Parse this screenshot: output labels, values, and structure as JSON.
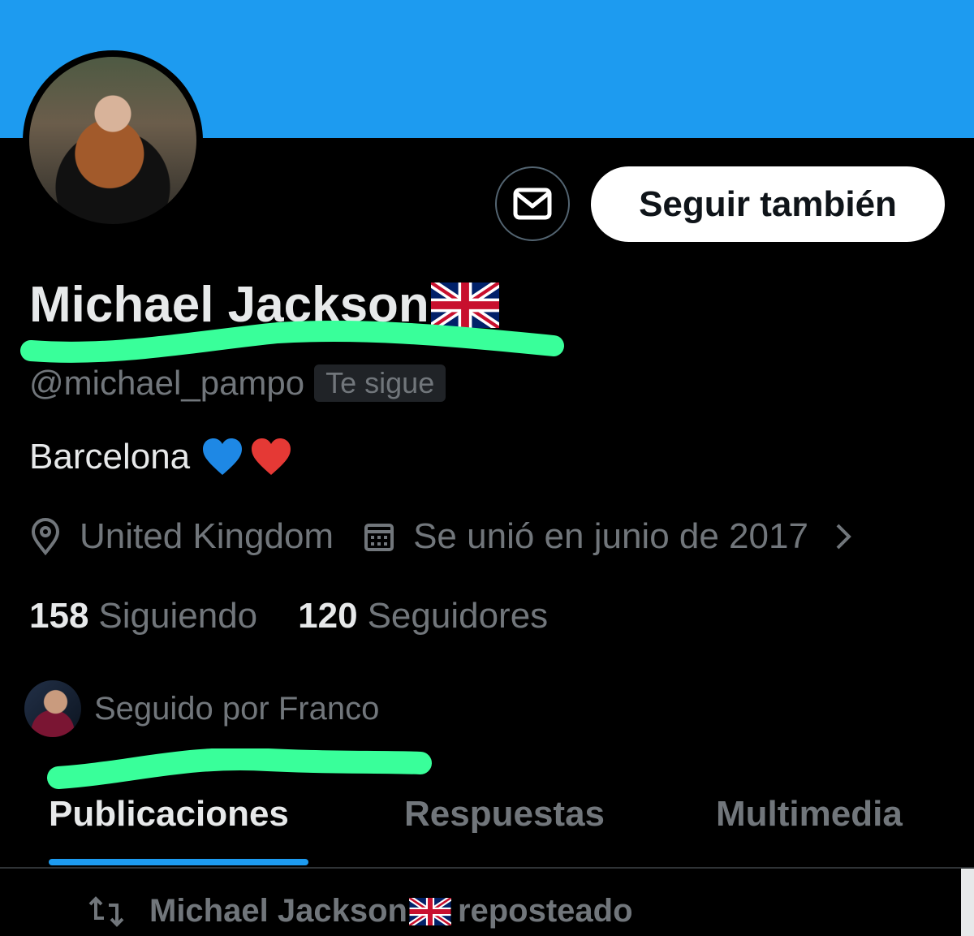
{
  "header": {
    "banner_color": "#1d9bf0"
  },
  "actions": {
    "follow_back_label": "Seguir también",
    "message_icon": "envelope-icon"
  },
  "profile": {
    "name": "Michael Jackson",
    "flag": "gb-flag-icon",
    "handle": "@michael_pampo",
    "follows_you_badge": "Te sigue",
    "bio": "Barcelona",
    "bio_emojis": [
      "blue-heart-icon",
      "red-heart-icon"
    ],
    "location": "United Kingdom",
    "joined": "Se unió en junio de 2017",
    "following_count": "158",
    "following_label": "Siguiendo",
    "followers_count": "120",
    "followers_label": "Seguidores",
    "followed_by": "Seguido por Franco"
  },
  "tabs": [
    {
      "label": "Publicaciones",
      "active": true
    },
    {
      "label": "Respuestas",
      "active": false
    },
    {
      "label": "Multimedia",
      "active": false
    }
  ],
  "feed": {
    "repost_name": "Michael Jackson",
    "repost_suffix": "reposteado"
  },
  "colors": {
    "accent": "#1d9bf0",
    "highlight_marker": "#39ff9a",
    "muted": "#71767b",
    "text": "#e7e9ea"
  }
}
